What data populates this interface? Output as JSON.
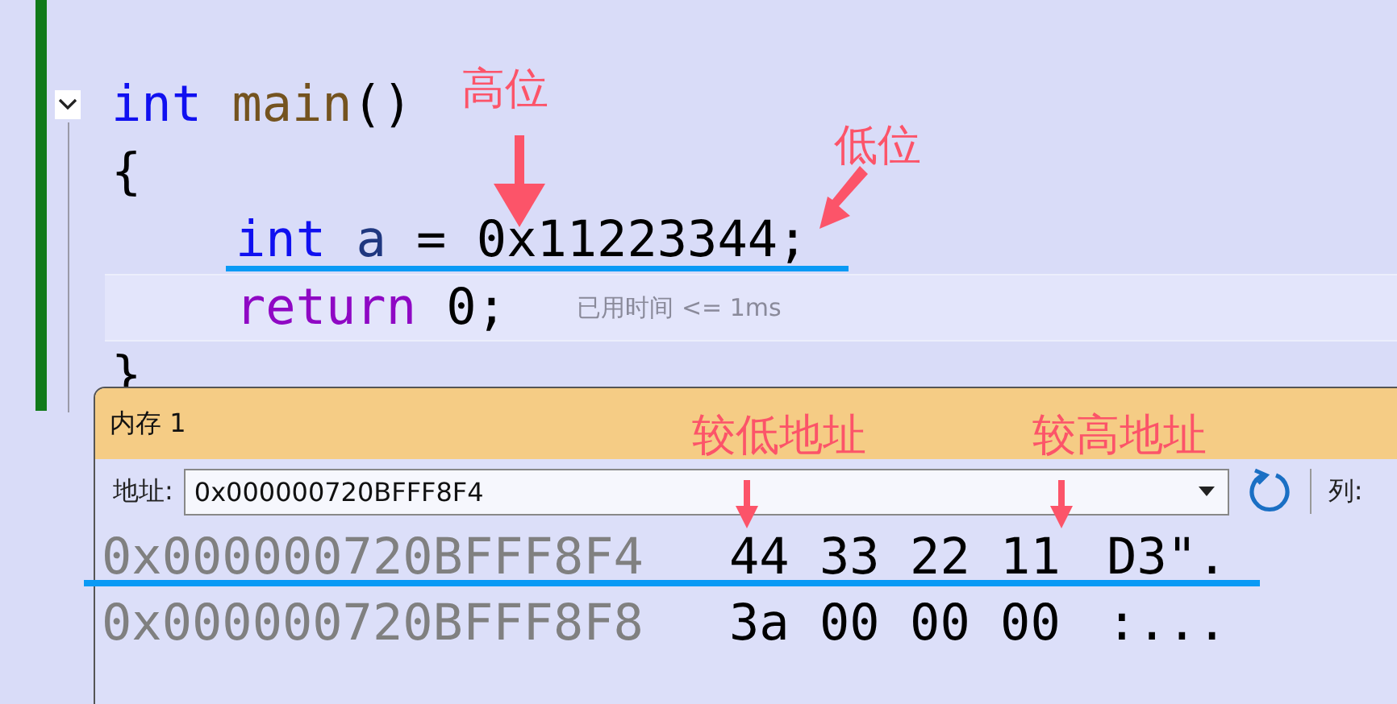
{
  "editor": {
    "lines": [
      {
        "indented": false,
        "foldable": true,
        "highlighted": false,
        "tokens": [
          {
            "text": "int",
            "kind": "keyword"
          },
          {
            "text": "main",
            "kind": "function"
          },
          {
            "text": "()",
            "kind": "punct",
            "attached": true
          }
        ]
      },
      {
        "indented": false,
        "foldable": false,
        "highlighted": false,
        "tokens": [
          {
            "text": "{",
            "kind": "punct"
          }
        ]
      },
      {
        "indented": true,
        "foldable": false,
        "highlighted": false,
        "tokens": [
          {
            "text": "int",
            "kind": "keyword"
          },
          {
            "text": "a",
            "kind": "variable"
          },
          {
            "text": "=",
            "kind": "punct"
          },
          {
            "text": "0x11223344;",
            "kind": "number"
          }
        ]
      },
      {
        "indented": true,
        "foldable": false,
        "highlighted": true,
        "hint": "已用时间 <= 1ms",
        "tokens": [
          {
            "text": "return",
            "kind": "control"
          },
          {
            "text": "0;",
            "kind": "number"
          }
        ]
      },
      {
        "indented": false,
        "foldable": false,
        "highlighted": false,
        "tokens": [
          {
            "text": "}",
            "kind": "punct"
          }
        ]
      }
    ]
  },
  "memory_window": {
    "title": "内存 1",
    "address_label": "地址:",
    "address_value": "0x000000720BFFF8F4",
    "column_label": "列:",
    "rows": [
      {
        "address": "0x000000720BFFF8F4",
        "bytes": [
          "44",
          "33",
          "22",
          "11"
        ],
        "ascii": "D3\"."
      },
      {
        "address": "0x000000720BFFF8F8",
        "bytes": [
          "3a",
          "00",
          "00",
          "00"
        ],
        "ascii": ":..."
      }
    ]
  },
  "annotations": [
    {
      "text": "高位"
    },
    {
      "text": "低位"
    },
    {
      "text": "较低地址"
    },
    {
      "text": "较高地址"
    }
  ]
}
